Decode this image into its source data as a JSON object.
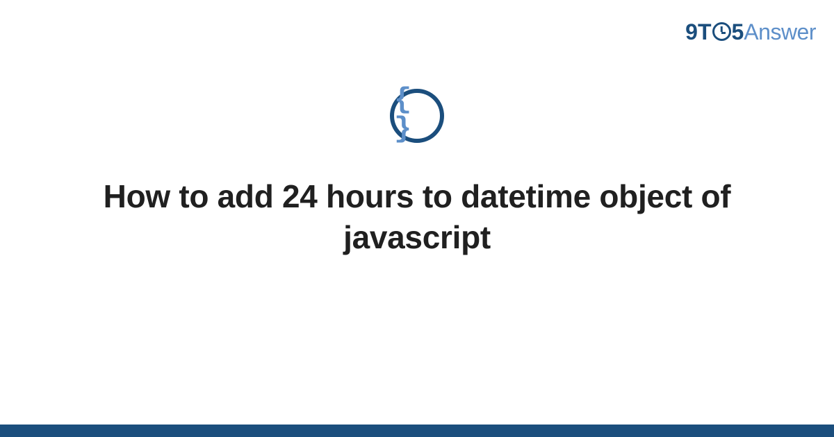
{
  "logo": {
    "part1": "9T",
    "part2": "5",
    "part3": "Answer"
  },
  "icon": {
    "glyph": "{ }",
    "name": "code-braces-icon"
  },
  "title": "How to add 24 hours to datetime object of javascript",
  "colors": {
    "primary": "#1b4e7d",
    "secondary": "#5d8fc9",
    "text": "#202020"
  }
}
